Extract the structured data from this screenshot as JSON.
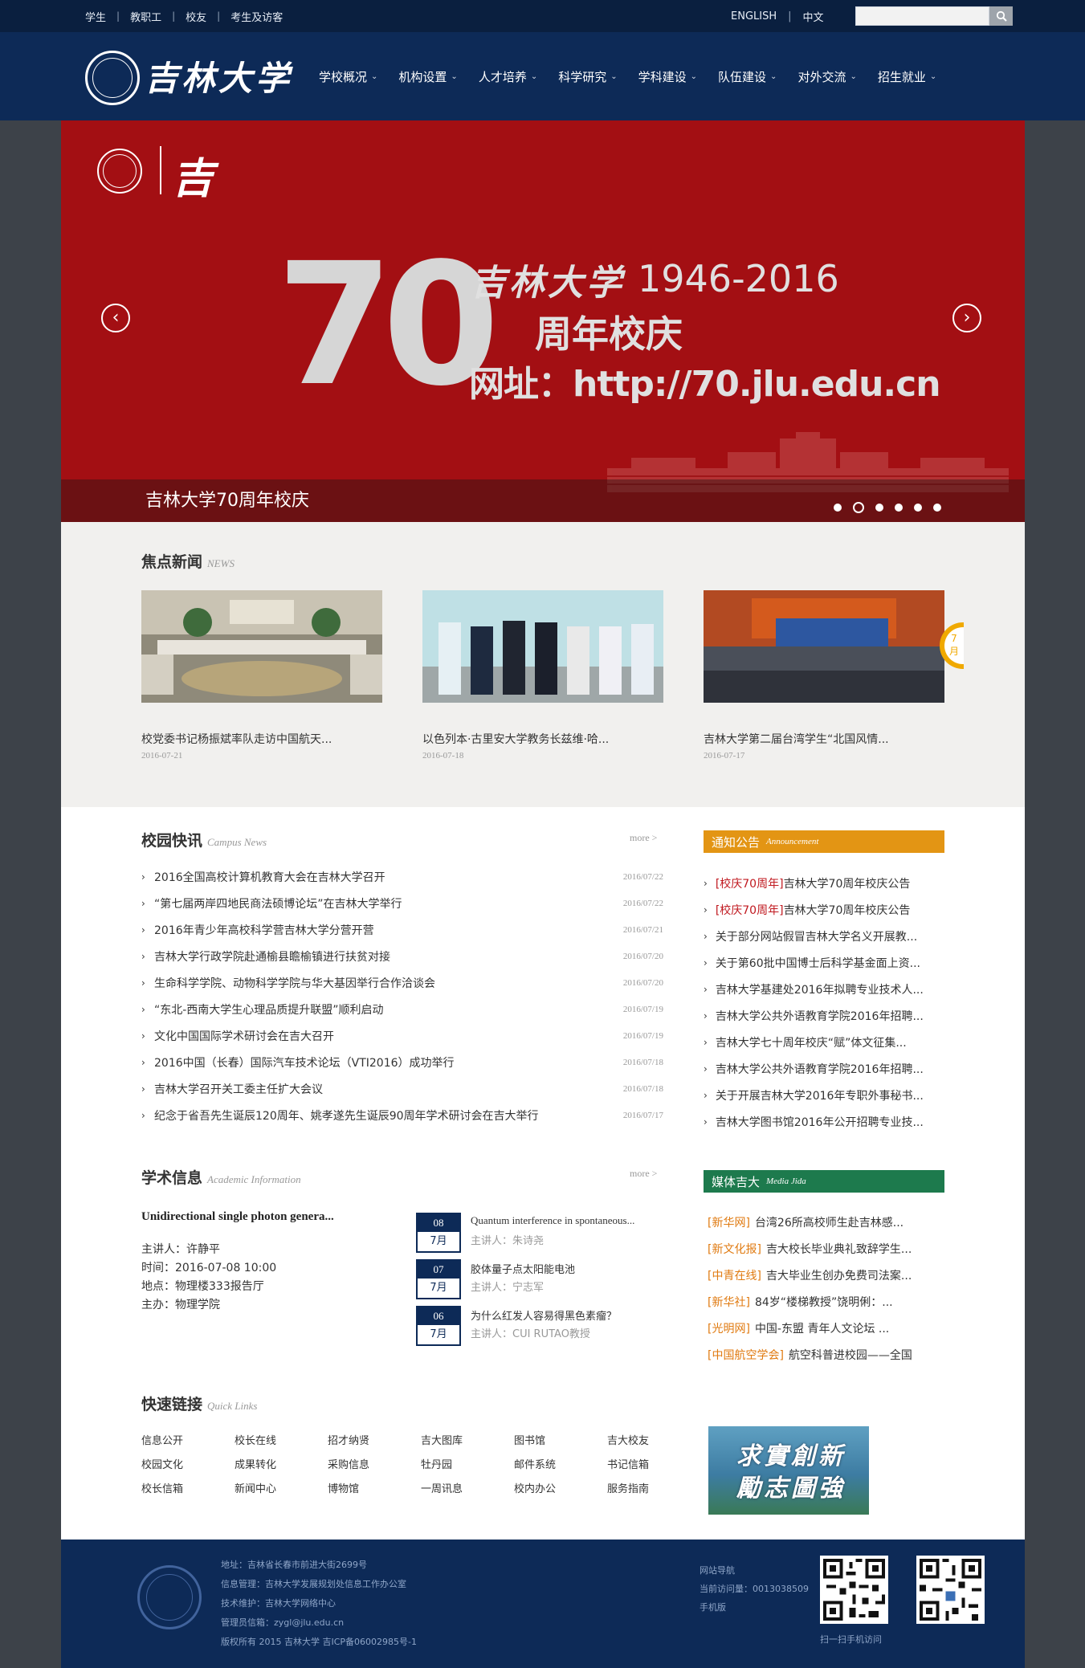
{
  "topbar": {
    "links": [
      "学生",
      "教职工",
      "校友",
      "考生及访客"
    ],
    "lang_en": "ENGLISH",
    "lang_zh": "中文",
    "search_placeholder": ""
  },
  "header": {
    "logo_text": "吉林大学",
    "nav": [
      "学校概况",
      "机构设置",
      "人才培养",
      "科学研究",
      "学科建设",
      "队伍建设",
      "对外交流",
      "招生就业"
    ]
  },
  "banner": {
    "big_number": "70",
    "school": "吉林大学",
    "years": "1946-2016",
    "jubilee": "周年校庆",
    "url": "网址：http://70.jlu.edu.cn",
    "caption": "吉林大学70周年校庆",
    "slide_count": 6,
    "active_slide": 2,
    "prev_icon": "‹",
    "next_icon": "›"
  },
  "focus": {
    "title": "焦点新闻",
    "title_en": "NEWS",
    "items": [
      {
        "caption": "校党委书记杨振斌率队走访中国航天...",
        "date": "2016-07-21"
      },
      {
        "caption": "以色列本·古里安大学教务长兹维·哈...",
        "date": "2016-07-18"
      },
      {
        "caption": "吉林大学第二届台湾学生“北国风情...",
        "date": "2016-07-17"
      }
    ],
    "side_tab_day": "7",
    "side_tab_month": "月"
  },
  "campus": {
    "title": "校园快讯",
    "title_en": "Campus News",
    "more": "more >",
    "items": [
      {
        "title": "2016全国高校计算机教育大会在吉林大学召开",
        "date": "2016/07/22"
      },
      {
        "title": "“第七届两岸四地民商法硕博论坛”在吉林大学举行",
        "date": "2016/07/22"
      },
      {
        "title": "2016年青少年高校科学营吉林大学分营开营",
        "date": "2016/07/21"
      },
      {
        "title": "吉林大学行政学院赴通榆县瞻榆镇进行扶贫对接",
        "date": "2016/07/20"
      },
      {
        "title": "生命科学学院、动物科学学院与华大基因举行合作洽谈会",
        "date": "2016/07/20"
      },
      {
        "title": "“东北-西南大学生心理品质提升联盟”顺利启动",
        "date": "2016/07/19"
      },
      {
        "title": "文化中国国际学术研讨会在吉大召开",
        "date": "2016/07/19"
      },
      {
        "title": "2016中国（长春）国际汽车技术论坛（VTI2016）成功举行",
        "date": "2016/07/18"
      },
      {
        "title": "吉林大学召开关工委主任扩大会议",
        "date": "2016/07/18"
      },
      {
        "title": "纪念于省吾先生诞辰120周年、姚孝遂先生诞辰90周年学术研讨会在吉大举行",
        "date": "2016/07/17"
      }
    ]
  },
  "announcements": {
    "title": "通知公告",
    "title_en": "Announcement",
    "color": "#e39514",
    "items": [
      {
        "tag": "[校庆70周年]",
        "text": "吉林大学70周年校庆公告"
      },
      {
        "tag": "[校庆70周年]",
        "text": "吉林大学70周年校庆公告"
      },
      {
        "tag": "",
        "text": "关于部分网站假冒吉林大学名义开展教..."
      },
      {
        "tag": "",
        "text": "关于第60批中国博士后科学基金面上资..."
      },
      {
        "tag": "",
        "text": "吉林大学基建处2016年拟聘专业技术人..."
      },
      {
        "tag": "",
        "text": "吉林大学公共外语教育学院2016年招聘..."
      },
      {
        "tag": "",
        "text": "吉林大学七十周年校庆“赋”体文征集..."
      },
      {
        "tag": "",
        "text": "吉林大学公共外语教育学院2016年招聘..."
      },
      {
        "tag": "",
        "text": "关于开展吉林大学2016年专职外事秘书..."
      },
      {
        "tag": "",
        "text": "吉林大学图书馆2016年公开招聘专业技..."
      }
    ]
  },
  "academic": {
    "title": "学术信息",
    "title_en": "Academic Information",
    "more": "more >",
    "feature": {
      "title": "Unidirectional single photon genera...",
      "speaker": "主讲人：许静平",
      "time": "时间：2016-07-08 10:00",
      "place": "地点：物理楼333报告厅",
      "host": "主办：物理学院"
    },
    "items": [
      {
        "day": "08",
        "month": "7月",
        "title": "Quantum interference in spontaneous...",
        "speaker": "主讲人：朱诗尧"
      },
      {
        "day": "07",
        "month": "7月",
        "title": "胶体量子点太阳能电池",
        "speaker": "主讲人：宁志军"
      },
      {
        "day": "06",
        "month": "7月",
        "title": "为什么红发人容易得黑色素瘤？",
        "speaker": "主讲人：CUI RUTAO教授"
      }
    ]
  },
  "media": {
    "title": "媒体吉大",
    "title_en": "Media Jida",
    "color": "#1d7a4d",
    "items": [
      {
        "tag": "[新华网]",
        "text": "台湾26所高校师生赴吉林感..."
      },
      {
        "tag": "[新文化报]",
        "text": "吉大校长毕业典礼致辞学生..."
      },
      {
        "tag": "[中青在线]",
        "text": "吉大毕业生创办免费司法案..."
      },
      {
        "tag": "[新华社]",
        "text": "84岁“楼梯教授”饶明俐：..."
      },
      {
        "tag": "[光明网]",
        "text": "中国-东盟 青年人文论坛 ..."
      },
      {
        "tag": "[中国航空学会]",
        "text": "航空科普进校园——全国"
      }
    ]
  },
  "quicklinks": {
    "title": "快速链接",
    "title_en": "Quick Links",
    "rows": [
      [
        "信息公开",
        "校长在线",
        "招才纳贤",
        "吉大图库",
        "图书馆",
        "吉大校友"
      ],
      [
        "校园文化",
        "成果转化",
        "采购信息",
        "牡丹园",
        "邮件系统",
        "书记信箱"
      ],
      [
        "校长信箱",
        "新闻中心",
        "博物馆",
        "一周讯息",
        "校内办公",
        "服务指南"
      ]
    ],
    "motto_line1": "求實創新",
    "motto_line2": "勵志圖強"
  },
  "footer": {
    "address": "地址：吉林省长春市前进大街2699号",
    "info_mgmt": "信息管理：吉林大学发展规划处信息工作办公室",
    "tech": "技术维护：吉林大学网络中心",
    "admin_mail": "管理员信箱：zygl@jlu.edu.cn",
    "copyright": "版权所有 2015 吉林大学 吉ICP备06002985号-1",
    "site_nav": "网站导航",
    "visits": "当前访问量：0013038509",
    "mobile": "手机版",
    "qr_caption": "扫一扫手机访问"
  },
  "colors": {
    "navy": "#0d2a57",
    "banner_red": "#a30f13",
    "accent_red": "#c0181f",
    "orange": "#e07a10"
  }
}
